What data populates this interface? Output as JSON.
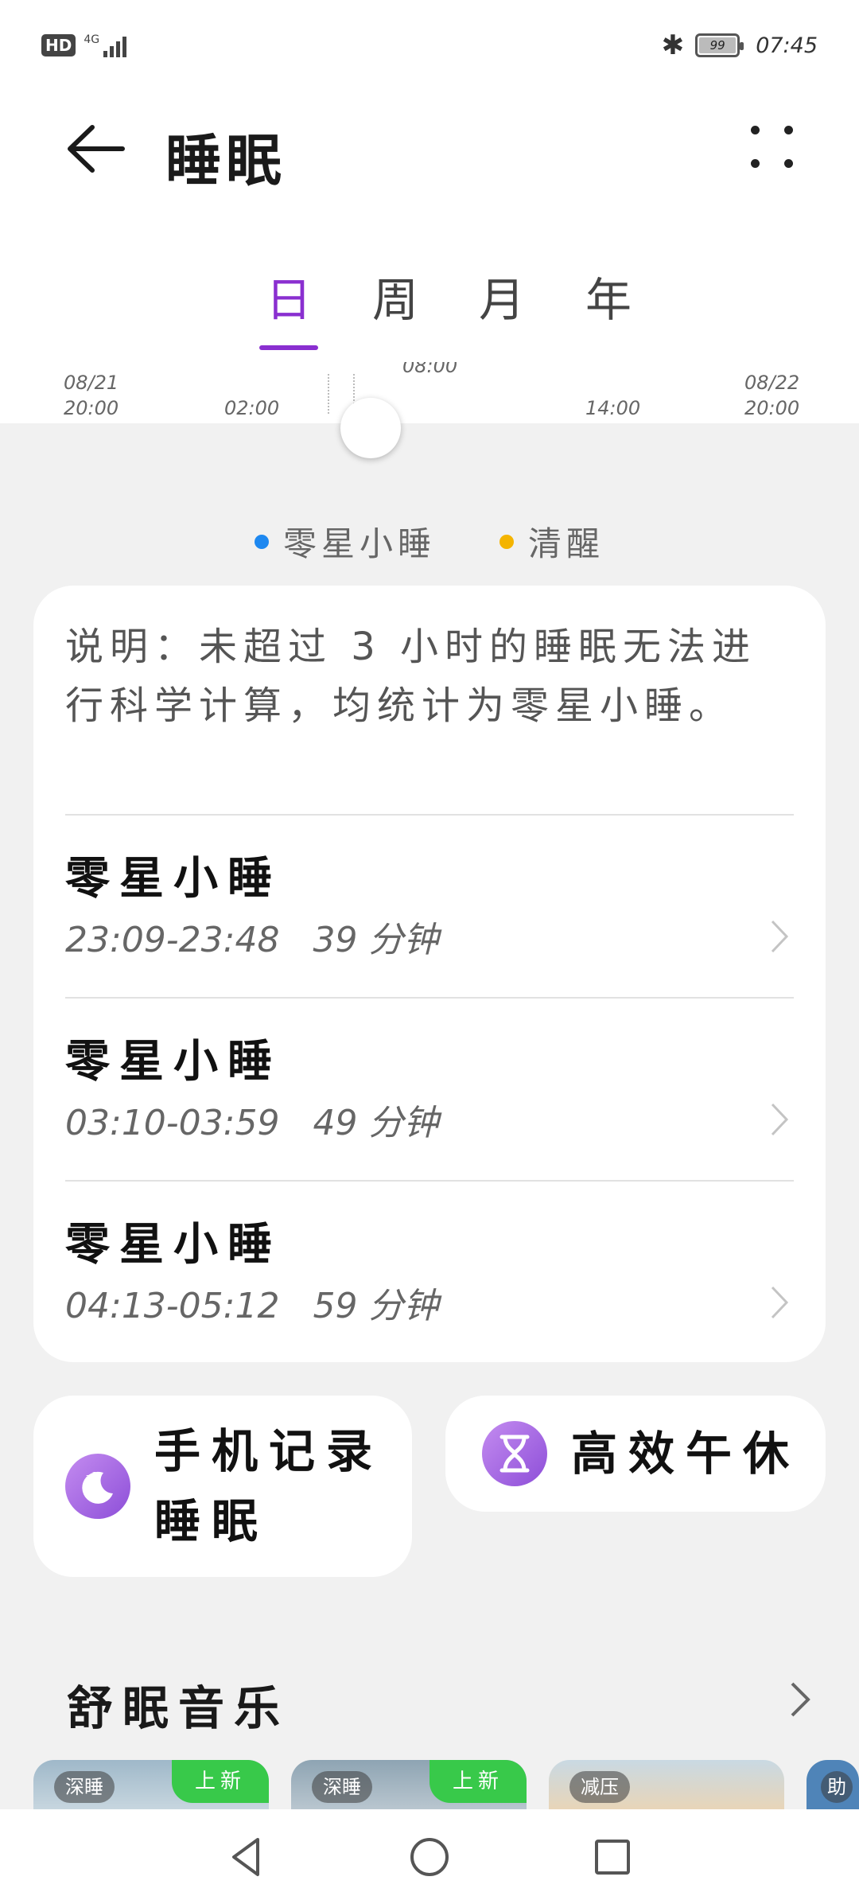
{
  "status_bar": {
    "hd": "HD",
    "network": "4G",
    "battery": "99",
    "time": "07:45"
  },
  "header": {
    "title": "睡眠"
  },
  "tabs": [
    {
      "label": "日",
      "active": true
    },
    {
      "label": "周",
      "active": false
    },
    {
      "label": "月",
      "active": false
    },
    {
      "label": "年",
      "active": false
    }
  ],
  "timeline": {
    "start_date": "08/21",
    "start_time": "20:00",
    "t1": "02:00",
    "current": "08:00",
    "t2": "14:00",
    "end_date": "08/22",
    "end_time": "20:00"
  },
  "legend": [
    {
      "label": "零星小睡",
      "color": "#1e88f0"
    },
    {
      "label": "清醒",
      "color": "#f4b400"
    }
  ],
  "note": "说明：未超过 3 小时的睡眠无法进行科学计算，均统计为零星小睡。",
  "naps": [
    {
      "title": "零星小睡",
      "range": "23:09-23:48",
      "duration": "39 分钟"
    },
    {
      "title": "零星小睡",
      "range": "03:10-03:59",
      "duration": "49 分钟"
    },
    {
      "title": "零星小睡",
      "range": "04:13-05:12",
      "duration": "59 分钟"
    }
  ],
  "tiles": {
    "record_sleep": "手机记录睡眠",
    "record_sleep_line1": "手机记录",
    "record_sleep_line2": "睡眠",
    "nap": "高效午休"
  },
  "music": {
    "title": "舒眠音乐",
    "items": [
      {
        "tag": "深睡",
        "badge": "上新"
      },
      {
        "tag": "深睡",
        "badge": "上新"
      },
      {
        "tag": "减压",
        "badge": ""
      },
      {
        "tag": "助",
        "badge": ""
      }
    ]
  },
  "colors": {
    "accent": "#8a2fd0",
    "background": "#f1f1f1",
    "card": "#ffffff"
  }
}
